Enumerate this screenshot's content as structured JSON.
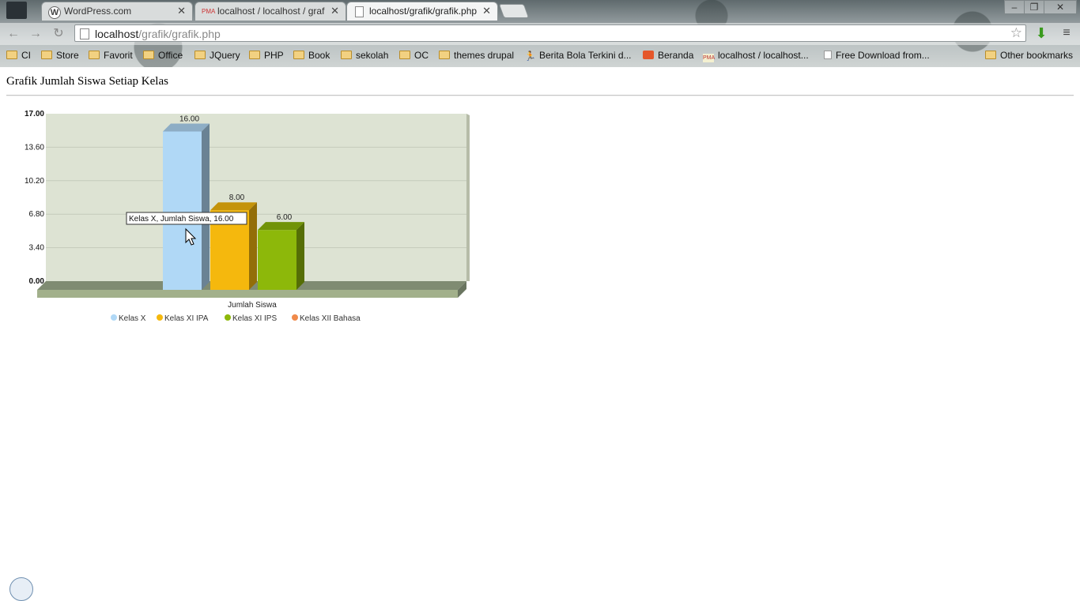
{
  "browser": {
    "tabs": [
      {
        "title": "WordPress.com",
        "icon": "wordpress-icon",
        "active": false
      },
      {
        "title": "localhost / localhost / grafik",
        "icon": "phpmyadmin-icon",
        "active": false
      },
      {
        "title": "localhost/grafik/grafik.php",
        "icon": "page-icon",
        "active": true
      }
    ],
    "url_host": "localhost",
    "url_path": "/grafik/grafik.php",
    "bookmarks": [
      {
        "label": "CI",
        "icon": "folder"
      },
      {
        "label": "Store",
        "icon": "folder"
      },
      {
        "label": "Favorit",
        "icon": "folder"
      },
      {
        "label": "Office",
        "icon": "folder"
      },
      {
        "label": "JQuery",
        "icon": "folder"
      },
      {
        "label": "PHP",
        "icon": "folder"
      },
      {
        "label": "Book",
        "icon": "folder"
      },
      {
        "label": "sekolah",
        "icon": "folder"
      },
      {
        "label": "OC",
        "icon": "folder"
      },
      {
        "label": "themes drupal",
        "icon": "folder"
      },
      {
        "label": "Berita Bola Terkini d...",
        "icon": "runner"
      },
      {
        "label": "Beranda",
        "icon": "beranda"
      },
      {
        "label": "localhost / localhost...",
        "icon": "pma"
      },
      {
        "label": "Free Download from...",
        "icon": "page"
      }
    ],
    "other_bookmarks": "Other bookmarks"
  },
  "page": {
    "title": "Grafik Jumlah Siswa Setiap Kelas"
  },
  "chart_data": {
    "type": "bar",
    "categories": [
      "Jumlah Siswa"
    ],
    "xlabel": "Jumlah Siswa",
    "ylabel": "",
    "ylim": [
      0,
      17
    ],
    "yticks": [
      "0.00",
      "3.40",
      "6.80",
      "10.20",
      "13.60",
      "17.00"
    ],
    "series": [
      {
        "name": "Kelas X",
        "values": [
          16
        ],
        "label": "16.00",
        "color": "#b0d8f6"
      },
      {
        "name": "Kelas XI IPA",
        "values": [
          8
        ],
        "label": "8.00",
        "color": "#f5b80d"
      },
      {
        "name": "Kelas XI IPS",
        "values": [
          6
        ],
        "label": "6.00",
        "color": "#8db80a"
      },
      {
        "name": "Kelas XII Bahasa",
        "values": [
          0
        ],
        "label": "",
        "color": "#f08a4b"
      }
    ],
    "tooltip": "Kelas X, Jumlah Siswa, 16.00",
    "legend_position": "bottom",
    "grid": true
  }
}
